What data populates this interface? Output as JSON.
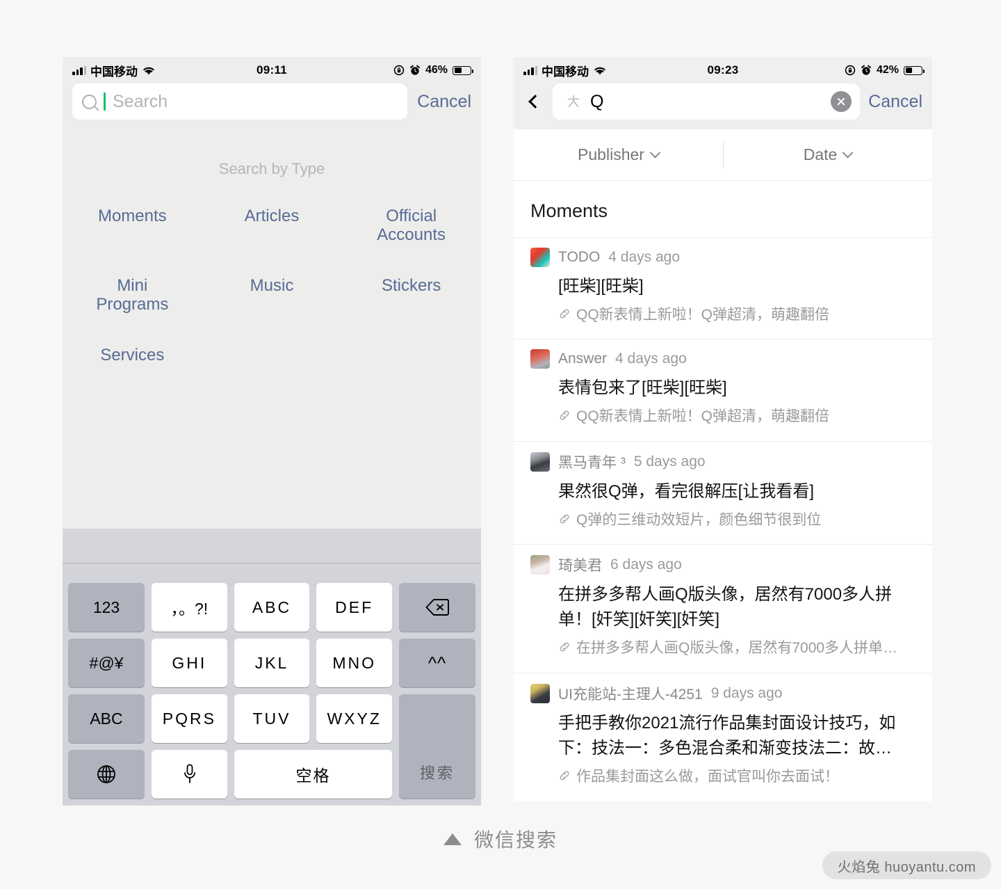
{
  "left_phone": {
    "status_bar": {
      "carrier": "中国移动",
      "time": "09:11",
      "battery_percent": "46%",
      "icons": [
        "signal-bars-icon",
        "wifi-icon",
        "rotation-lock-icon",
        "alarm-clock-icon",
        "battery-icon"
      ]
    },
    "search": {
      "placeholder": "Search",
      "value": "",
      "cancel_label": "Cancel",
      "caret_color": "#07c160"
    },
    "search_by_type": {
      "title": "Search by Type",
      "items": [
        "Moments",
        "Articles",
        "Official\nAccounts",
        "Mini\nPrograms",
        "Music",
        "Stickers",
        "Services"
      ],
      "link_color": "#576b95"
    },
    "keyboard": {
      "rows": [
        [
          {
            "label": "123",
            "style": "grey",
            "name": "key-123"
          },
          {
            "label": "，。?!",
            "style": "white",
            "name": "key-punctuation"
          },
          {
            "label": "ABC",
            "style": "white",
            "name": "key-abc"
          },
          {
            "label": "DEF",
            "style": "white",
            "name": "key-def"
          },
          {
            "label": "",
            "style": "grey",
            "name": "key-backspace",
            "icon": "backspace-icon"
          }
        ],
        [
          {
            "label": "#@¥",
            "style": "grey",
            "name": "key-symbols"
          },
          {
            "label": "GHI",
            "style": "white",
            "name": "key-ghi"
          },
          {
            "label": "JKL",
            "style": "white",
            "name": "key-jkl"
          },
          {
            "label": "MNO",
            "style": "white",
            "name": "key-mno"
          },
          {
            "label": "^^",
            "style": "grey",
            "name": "key-emoticon"
          }
        ],
        [
          {
            "label": "ABC",
            "style": "grey",
            "name": "key-abc-mode"
          },
          {
            "label": "PQRS",
            "style": "white",
            "name": "key-pqrs"
          },
          {
            "label": "TUV",
            "style": "white",
            "name": "key-tuv"
          },
          {
            "label": "WXYZ",
            "style": "white",
            "name": "key-wxyz"
          },
          {
            "label": "搜索",
            "style": "grey",
            "name": "key-search-enter"
          }
        ],
        [
          {
            "label": "",
            "style": "grey",
            "name": "key-globe",
            "icon": "globe-icon"
          },
          {
            "label": "",
            "style": "white",
            "name": "key-microphone",
            "icon": "microphone-icon"
          },
          {
            "label": "空格",
            "style": "white",
            "name": "key-space"
          }
        ]
      ]
    }
  },
  "right_phone": {
    "status_bar": {
      "carrier": "中国移动",
      "time": "09:23",
      "battery_percent": "42%"
    },
    "search": {
      "value": "Q",
      "cancel_label": "Cancel",
      "back_icon": "back-chevron-icon",
      "search_icon": "wechat-search-icon",
      "clear_icon": "clear-circle-icon"
    },
    "filters": [
      {
        "label": "Publisher",
        "name": "filter-publisher"
      },
      {
        "label": "Date",
        "name": "filter-date"
      }
    ],
    "section_title": "Moments",
    "results": [
      {
        "author": "TODO",
        "time": "4 days ago",
        "body": "[旺柴][旺柴]",
        "link": "QQ新表情上新啦！Q弹超清，萌趣翻倍",
        "avatar_class": "av1"
      },
      {
        "author": "Answer",
        "time": "4 days ago",
        "body": "表情包来了[旺柴][旺柴]",
        "link": "QQ新表情上新啦！Q弹超清，萌趣翻倍",
        "avatar_class": "av2"
      },
      {
        "author": "黑马青年 ³",
        "time": "5 days ago",
        "body": "果然很Q弹，看完很解压[让我看看]",
        "link": "Q弹的三维动效短片，颜色细节很到位",
        "avatar_class": "av3"
      },
      {
        "author": "琦美君",
        "time": "6 days ago",
        "body": "在拼多多帮人画Q版头像，居然有7000多人拼单！[奸笑][奸笑][奸笑]",
        "link": "在拼多多帮人画Q版头像，居然有7000多人拼单…",
        "avatar_class": "av4"
      },
      {
        "author": "UI充能站-主理人-4251",
        "time": "9 days ago",
        "body": "手把手教你2021流行作品集封面设计技巧，如下：技法一：多色混合柔和渐变技法二：故…",
        "link": "作品集封面这么做，面试官叫你去面试！",
        "avatar_class": "av5"
      }
    ]
  },
  "footer": {
    "label": "微信搜索",
    "triangle_icon": "triangle-up-icon"
  },
  "watermark": {
    "text": "火焰兔 huoyantu.com"
  }
}
